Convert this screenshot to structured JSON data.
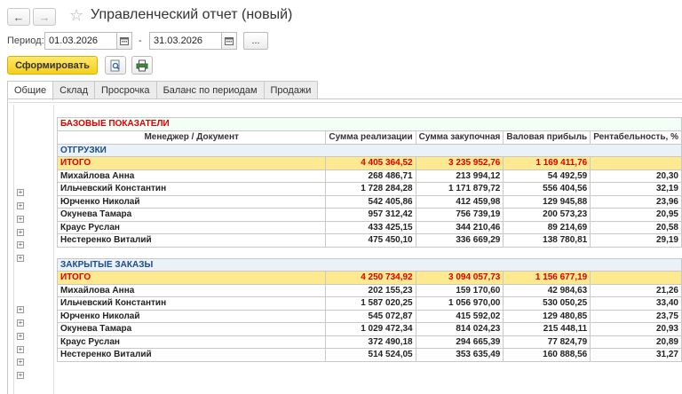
{
  "window": {
    "title": "Управленческий отчет (новый)"
  },
  "nav": {
    "back": "←",
    "forward": "→",
    "star": "☆"
  },
  "period": {
    "label": "Период:",
    "from": "01.03.2026",
    "to": "31.03.2026",
    "dash": "-",
    "dots": "..."
  },
  "toolbar": {
    "generate_label": "Сформировать"
  },
  "tabs": [
    "Общие",
    "Склад",
    "Просрочка",
    "Баланс по периодам",
    "Продажи"
  ],
  "report": {
    "title": "БАЗОВЫЕ ПОКАЗАТЕЛИ",
    "columns": [
      "Менеджер / Документ",
      "Сумма реализации",
      "Сумма закупочная",
      "Валовая прибыль",
      "Рентабельность, %"
    ],
    "sections": [
      {
        "name": "ОТГРУЗКИ",
        "total": {
          "label": "ИТОГО",
          "sales": "4 405 364,52",
          "purchase": "3 235 952,76",
          "profit": "1 169 411,76",
          "margin": ""
        },
        "rows": [
          {
            "name": "Михайлова Анна",
            "sales": "268 486,71",
            "purchase": "213 994,12",
            "profit": "54 492,59",
            "margin": "20,30"
          },
          {
            "name": "Ильчевский Константин",
            "sales": "1 728 284,28",
            "purchase": "1 171 879,72",
            "profit": "556 404,56",
            "margin": "32,19"
          },
          {
            "name": "Юрченко Николай",
            "sales": "542 405,86",
            "purchase": "412 459,98",
            "profit": "129 945,88",
            "margin": "23,96"
          },
          {
            "name": "Окунева Тамара",
            "sales": "957 312,42",
            "purchase": "756 739,19",
            "profit": "200 573,23",
            "margin": "20,95"
          },
          {
            "name": "Краус Руслан",
            "sales": "433 425,15",
            "purchase": "344 210,46",
            "profit": "89 214,69",
            "margin": "20,58"
          },
          {
            "name": "Нестеренко Виталий",
            "sales": "475 450,10",
            "purchase": "336 669,29",
            "profit": "138 780,81",
            "margin": "29,19"
          }
        ]
      },
      {
        "name": "ЗАКРЫТЫЕ ЗАКАЗЫ",
        "total": {
          "label": "ИТОГО",
          "sales": "4 250 734,92",
          "purchase": "3 094 057,73",
          "profit": "1 156 677,19",
          "margin": ""
        },
        "rows": [
          {
            "name": "Михайлова Анна",
            "sales": "202 155,23",
            "purchase": "159 170,60",
            "profit": "42 984,63",
            "margin": "21,26"
          },
          {
            "name": "Ильчевский Константин",
            "sales": "1 587 020,25",
            "purchase": "1 056 970,00",
            "profit": "530 050,25",
            "margin": "33,40"
          },
          {
            "name": "Юрченко Николай",
            "sales": "545 072,87",
            "purchase": "415 592,02",
            "profit": "129 480,85",
            "margin": "23,75"
          },
          {
            "name": "Окунева Тамара",
            "sales": "1 029 472,34",
            "purchase": "814 024,23",
            "profit": "215 448,11",
            "margin": "20,93"
          },
          {
            "name": "Краус Руслан",
            "sales": "372 490,18",
            "purchase": "294 665,39",
            "profit": "77 824,79",
            "margin": "20,89"
          },
          {
            "name": "Нестеренко Виталий",
            "sales": "514 524,05",
            "purchase": "353 635,49",
            "profit": "160 888,56",
            "margin": "31,27"
          }
        ]
      }
    ]
  }
}
